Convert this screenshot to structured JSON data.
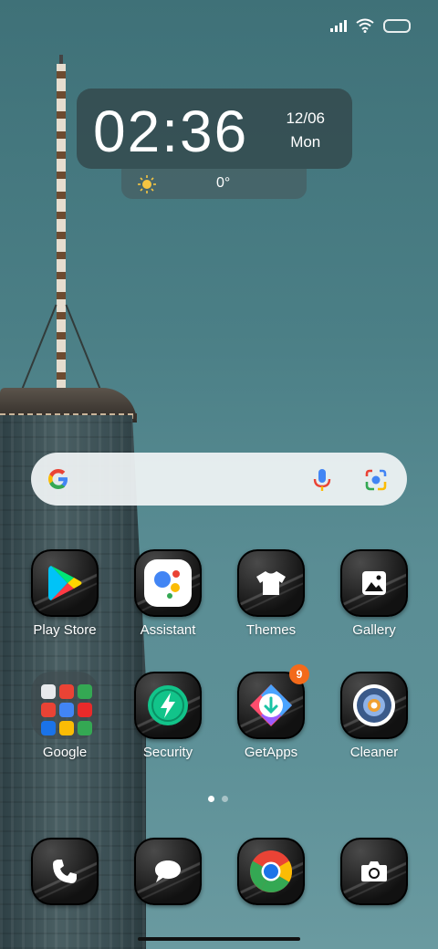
{
  "status_bar": {
    "signal": "signal-icon",
    "wifi": "wifi-icon",
    "battery": "battery-icon"
  },
  "clock_widget": {
    "time": "02:36",
    "date": "12/06",
    "weekday": "Mon"
  },
  "weather_widget": {
    "icon": "sun-icon",
    "temperature": "0°"
  },
  "search_bar": {
    "logo": "google-g-icon",
    "voice": "microphone-icon",
    "lens": "google-lens-icon"
  },
  "apps_row1": [
    {
      "label": "Play Store",
      "icon": "play-store-icon"
    },
    {
      "label": "Assistant",
      "icon": "assistant-icon"
    },
    {
      "label": "Themes",
      "icon": "tshirt-icon"
    },
    {
      "label": "Gallery",
      "icon": "gallery-icon"
    }
  ],
  "apps_row2": [
    {
      "label": "Google",
      "icon": "folder-icon"
    },
    {
      "label": "Security",
      "icon": "security-icon"
    },
    {
      "label": "GetApps",
      "icon": "getapps-icon",
      "badge": "9"
    },
    {
      "label": "Cleaner",
      "icon": "cleaner-icon"
    }
  ],
  "dock": [
    {
      "icon": "phone-icon"
    },
    {
      "icon": "messages-icon"
    },
    {
      "icon": "chrome-icon"
    },
    {
      "icon": "camera-icon"
    }
  ],
  "page_indicator": {
    "pages": 2,
    "current": 1
  },
  "colors": {
    "accent_badge": "#f36a1a",
    "widget_bg": "#344a4e"
  }
}
